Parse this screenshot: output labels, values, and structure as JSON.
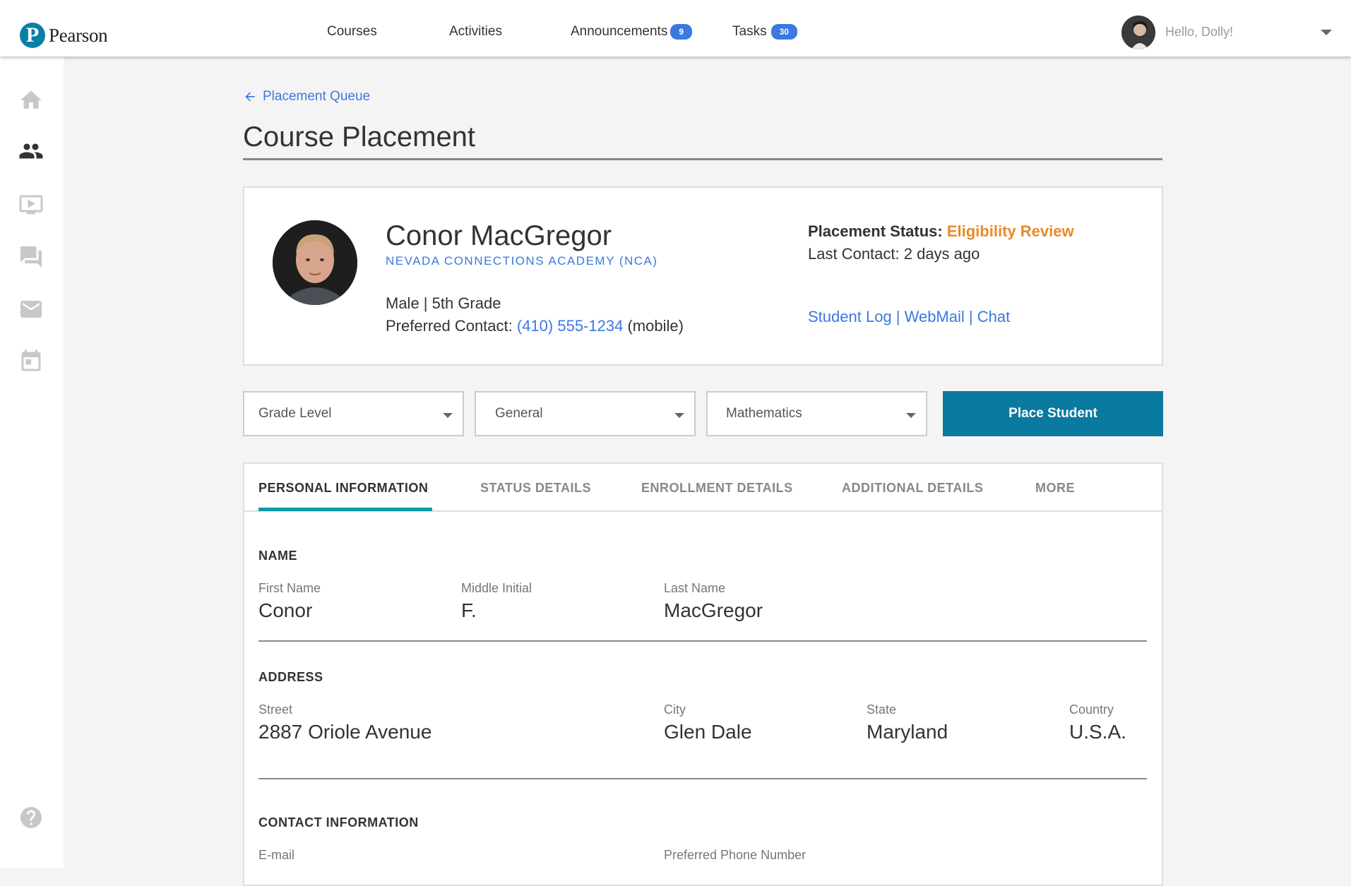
{
  "brand": {
    "name": "Pearson",
    "mark": "P",
    "color": "#0a7fa6"
  },
  "nav": {
    "courses": "Courses",
    "activities": "Activities",
    "announcements": {
      "label": "Announcements",
      "count": "9"
    },
    "tasks": {
      "label": "Tasks",
      "count": "30"
    }
  },
  "user": {
    "greeting": "Hello, Dolly!"
  },
  "sidebar": {
    "icons": [
      "home-icon",
      "people-icon",
      "video-icon",
      "chat-icon",
      "mail-icon",
      "calendar-icon",
      "help-icon"
    ]
  },
  "breadcrumb": {
    "back_label": "Placement Queue"
  },
  "page": {
    "title": "Course Placement"
  },
  "student": {
    "name": "Conor MacGregor",
    "school": "NEVADA CONNECTIONS ACADEMY (NCA)",
    "gender_grade": "Male | 5th Grade",
    "preferred_contact_label": "Preferred Contact: ",
    "phone": "(410) 555-1234",
    "phone_type": " (mobile)",
    "status_label": "Placement Status: ",
    "status_value": "Eligibility Review",
    "status_color": "#e88a2a",
    "last_contact": "Last Contact: 2 days ago",
    "links": "Student Log | WebMail | Chat"
  },
  "filters": {
    "grade_level": "Grade Level",
    "track": "General",
    "subject": "Mathematics",
    "place_button": "Place Student"
  },
  "tabs": [
    "PERSONAL INFORMATION",
    "STATUS DETAILS",
    "ENROLLMENT DETAILS",
    "ADDITIONAL DETAILS",
    "MORE"
  ],
  "personal": {
    "name_section": "NAME",
    "first_name_label": "First Name",
    "first_name": "Conor",
    "middle_label": "Middle Initial",
    "middle": "F.",
    "last_name_label": "Last Name",
    "last_name": "MacGregor",
    "address_section": "ADDRESS",
    "street_label": "Street",
    "street": "2887 Oriole Avenue",
    "city_label": "City",
    "city": "Glen Dale",
    "state_label": "State",
    "state": "Maryland",
    "country_label": "Country",
    "country": "U.S.A.",
    "contact_section": "CONTACT INFORMATION",
    "email_label": "E-mail",
    "phone_label": "Preferred Phone Number"
  },
  "colors": {
    "accent": "#3a79e0",
    "primary_button": "#0a7aa0",
    "tab_underline": "#0a9aa8"
  }
}
